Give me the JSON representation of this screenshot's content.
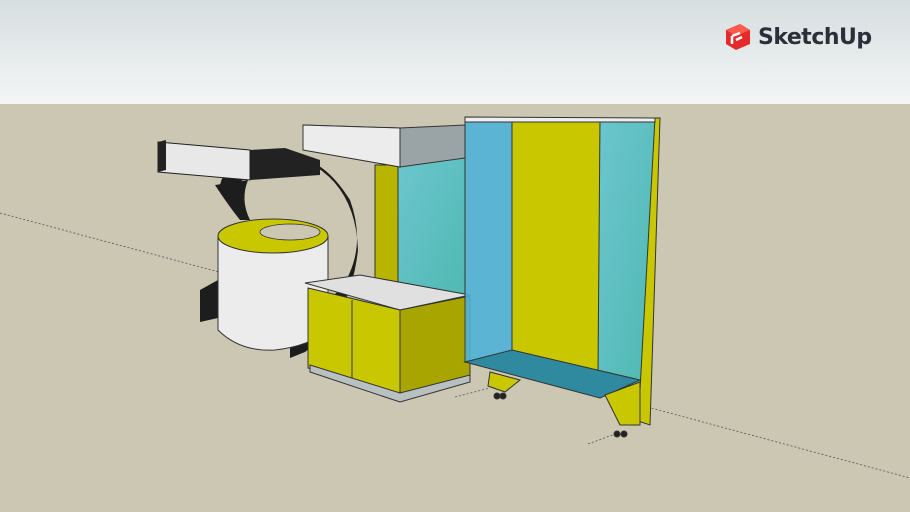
{
  "app": {
    "brand": "SketchUp"
  },
  "colors": {
    "sky_top": "#d7dfe1",
    "sky_bottom": "#f3f5f4",
    "ground": "#cbc7b2",
    "yellow": "#c9c800",
    "glass": "#5fc3c9",
    "logo_red": "#e42a2a"
  }
}
